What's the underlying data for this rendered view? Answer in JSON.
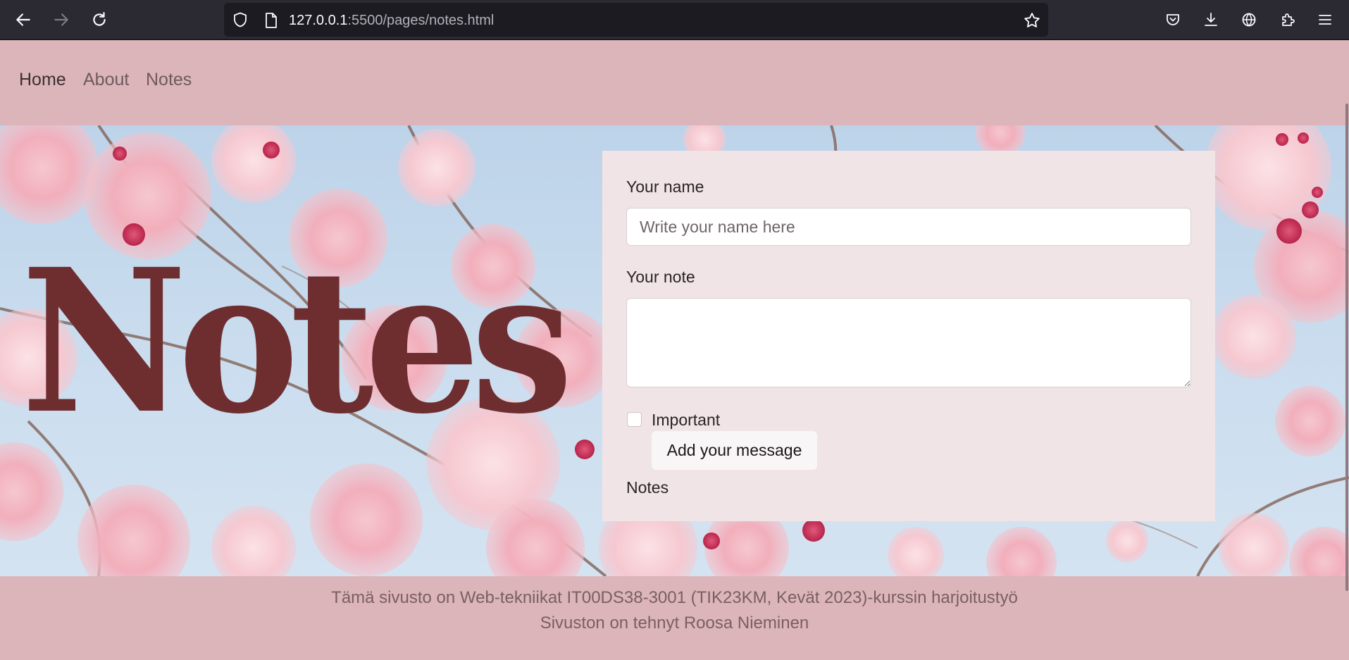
{
  "browser": {
    "url_host": "127.0.0.1",
    "url_rest": ":5500/pages/notes.html"
  },
  "nav": {
    "items": [
      {
        "label": "Home"
      },
      {
        "label": "About"
      },
      {
        "label": "Notes"
      }
    ]
  },
  "hero": {
    "title": "Notes"
  },
  "form": {
    "name_label": "Your name",
    "name_placeholder": "Write your name here",
    "name_value": "",
    "note_label": "Your note",
    "note_value": "",
    "important_label": "Important",
    "important_checked": false,
    "submit_label": "Add your message",
    "notes_heading": "Notes"
  },
  "footer": {
    "line1": "Tämä sivusto on Web-tekniikat IT00DS38-3001 (TIK23KM, Kevät 2023)-kurssin harjoitustyö",
    "line2": "Sivuston on tehnyt Roosa Nieminen"
  },
  "colors": {
    "nav_background": "#dbb5ba",
    "title_color": "#6e2e2f",
    "card_background": "#f1e4e6"
  }
}
